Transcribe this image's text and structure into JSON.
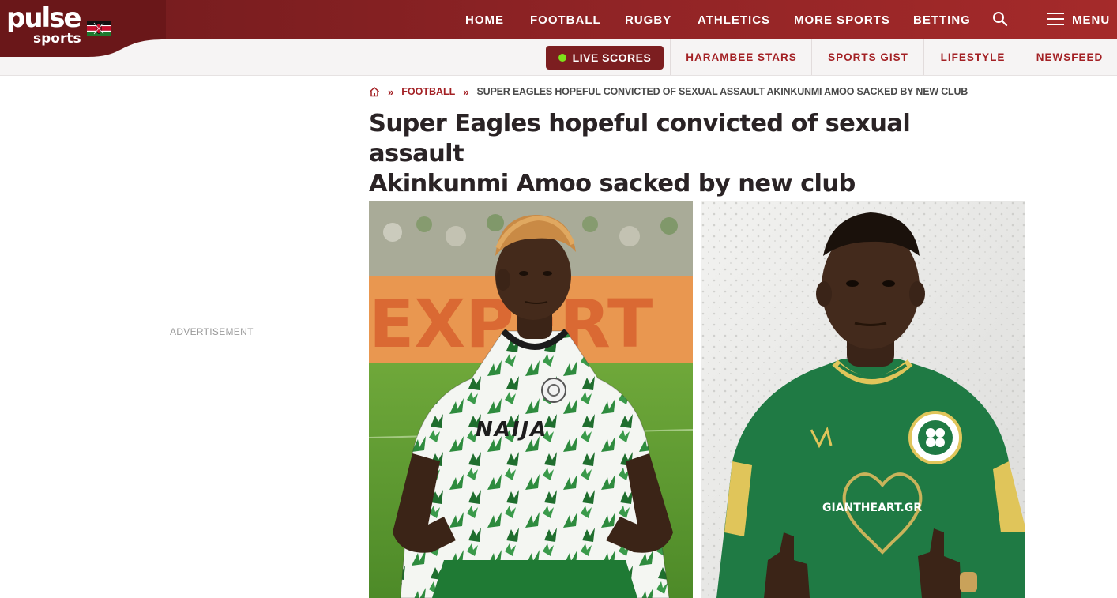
{
  "brand": {
    "logo_word": "pulse",
    "logo_sub": "sports",
    "flag_icon": "kenya-flag-icon",
    "colors": {
      "header_dark": "#6f1a1c",
      "header_light": "#a52a2a",
      "accent": "#a32024",
      "live_dot": "#7ee21a"
    }
  },
  "nav": {
    "items": [
      "HOME",
      "FOOTBALL",
      "RUGBY",
      "ATHLETICS",
      "MORE SPORTS",
      "BETTING"
    ],
    "search_icon": "search-icon",
    "menu_icon": "hamburger-icon",
    "menu_label": "MENU"
  },
  "subnav": {
    "live_scores": "LIVE SCORES",
    "items": [
      "HARAMBEE STARS",
      "SPORTS GIST",
      "LIFESTYLE",
      "NEWSFEED"
    ]
  },
  "breadcrumb": {
    "home_icon": "home-icon",
    "separator": "»",
    "category": "FOOTBALL",
    "current": "SUPER EAGLES HOPEFUL CONVICTED OF SEXUAL ASSAULT AKINKUNMI AMOO SACKED BY NEW CLUB"
  },
  "article": {
    "headline_line1": "Super Eagles hopeful convicted of sexual assault",
    "headline_line2": "Akinkunmi Amoo sacked by new club",
    "image_left_jersey_text": "NAIJA",
    "image_left_banner_text": "EXPERT",
    "image_right_sponsor_text": "GIANTHEART.GR"
  },
  "sidebar": {
    "ad_label": "ADVERTISEMENT"
  }
}
